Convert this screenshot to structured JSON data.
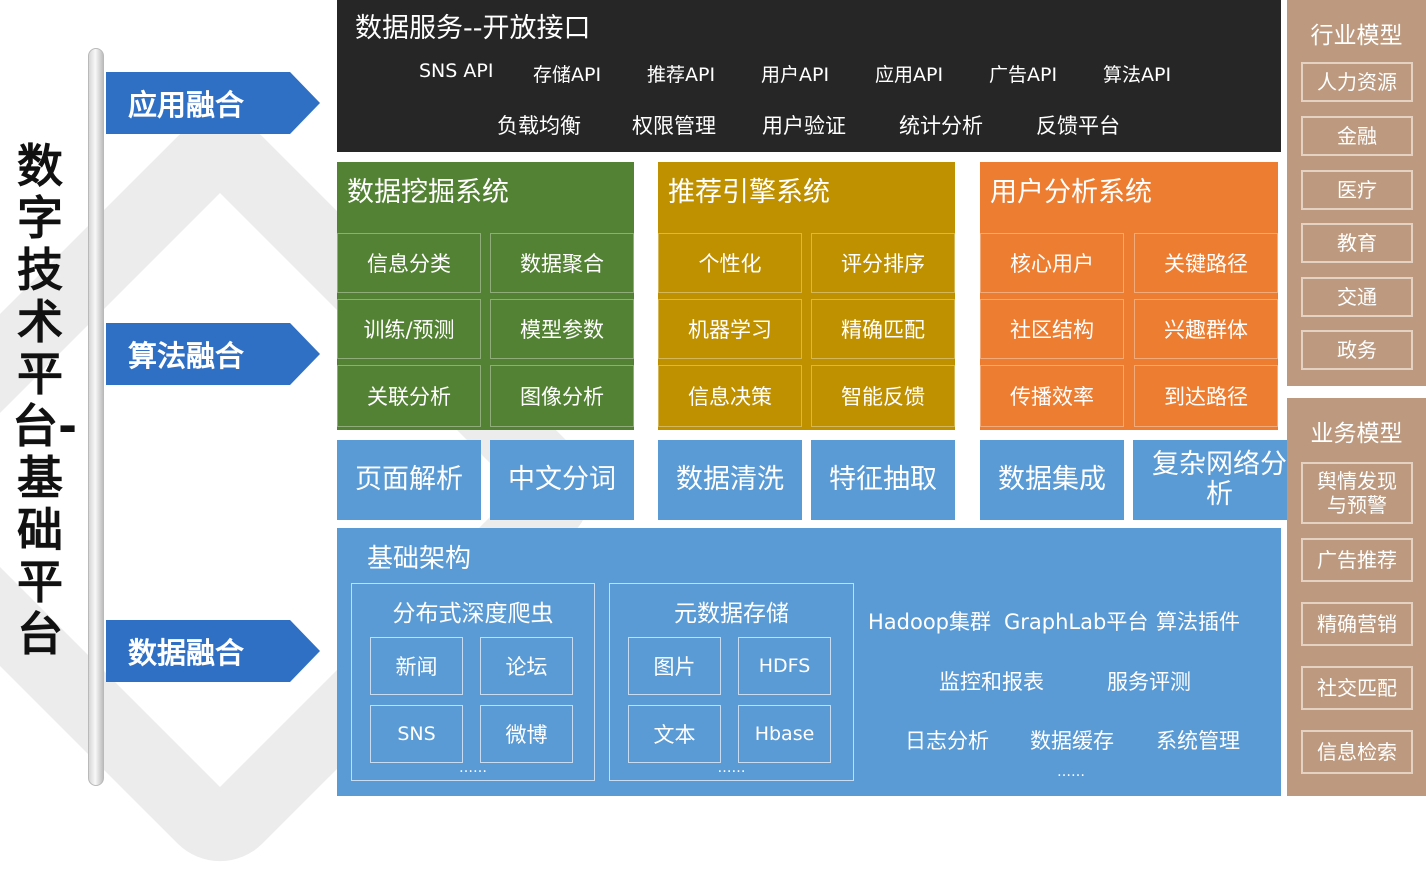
{
  "vertical_title": "数字技术平台-基础平台",
  "tags": {
    "app": "应用融合",
    "algo": "算法融合",
    "data": "数据融合"
  },
  "top": {
    "title": "数据服务--开放接口",
    "apis": [
      "SNS API",
      "存储API",
      "推荐API",
      "用户API",
      "应用API",
      "广告API",
      "算法API"
    ],
    "services": [
      "负载均衡",
      "权限管理",
      "用户验证",
      "统计分析",
      "反馈平台"
    ]
  },
  "mining": {
    "title": "数据挖掘系统",
    "cells": [
      "信息分类",
      "数据聚合",
      "训练/预测",
      "模型参数",
      "关联分析",
      "图像分析"
    ],
    "bottom": [
      "页面解析",
      "中文分词"
    ]
  },
  "recommend": {
    "title": "推荐引擎系统",
    "cells": [
      "个性化",
      "评分排序",
      "机器学习",
      "精确匹配",
      "信息决策",
      "智能反馈"
    ],
    "bottom": [
      "数据清洗",
      "特征抽取"
    ]
  },
  "user_analysis": {
    "title": "用户分析系统",
    "cells": [
      "核心用户",
      "关键路径",
      "社区结构",
      "兴趣群体",
      "传播效率",
      "到达路径"
    ],
    "bottom": [
      "数据集成",
      "复杂网络分析"
    ]
  },
  "infra": {
    "title": "基础架构",
    "crawler": {
      "title": "分布式深度爬虫",
      "cells": [
        "新闻",
        "论坛",
        "SNS",
        "微博"
      ],
      "more": "……"
    },
    "metadata": {
      "title": "元数据存储",
      "cells": [
        "图片",
        "HDFS",
        "文本",
        "Hbase"
      ],
      "more": "……"
    },
    "right": {
      "line1": [
        "Hadoop集群",
        "GraphLab平台",
        "算法插件"
      ],
      "line2": [
        "监控和报表",
        "服务评测"
      ],
      "line3": [
        "日志分析",
        "数据缓存",
        "系统管理"
      ],
      "more": "……"
    }
  },
  "industry": {
    "title": "行业模型",
    "items": [
      "人力资源",
      "金融",
      "医疗",
      "教育",
      "交通",
      "政务"
    ]
  },
  "business": {
    "title": "业务模型",
    "items": [
      "舆情发现与预警",
      "广告推荐",
      "精确营销",
      "社交匹配",
      "信息检索"
    ]
  },
  "colors": {
    "mining": "#548235",
    "recommend": "#bf9000",
    "user_analysis": "#ed7d31",
    "infra": "#5b9bd5",
    "top": "#262626",
    "tag": "#2f6fc4",
    "side": "#bd9a7f"
  }
}
